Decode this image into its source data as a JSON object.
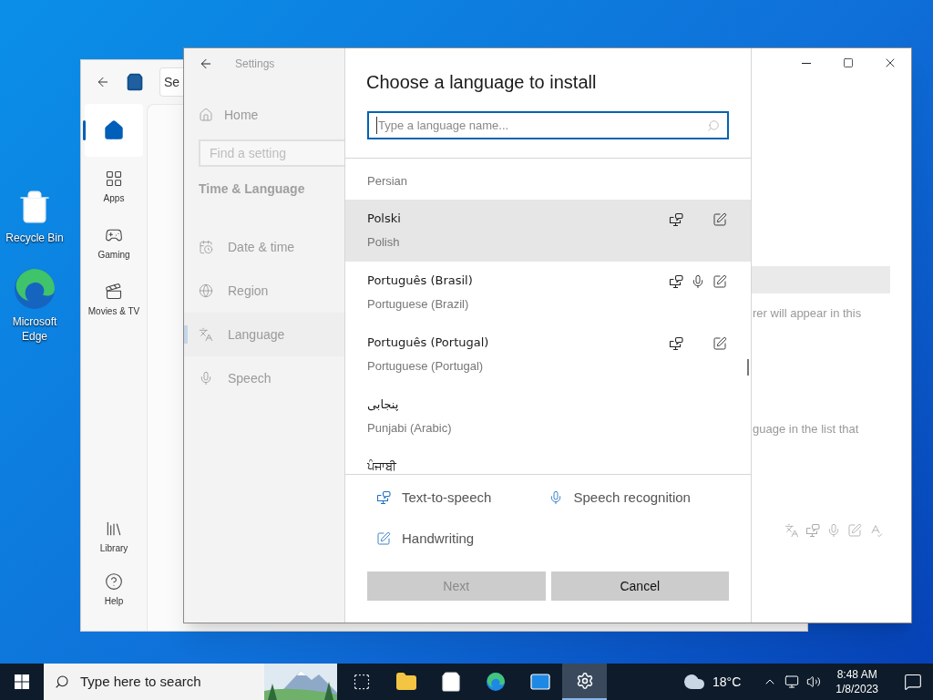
{
  "desktop_icons": [
    {
      "label": "Recycle Bin",
      "kind": "recycle"
    },
    {
      "label": "Microsoft Edge",
      "kind": "edge"
    }
  ],
  "store": {
    "search": "Se",
    "nav": [
      {
        "kind": "home",
        "selected": true
      },
      {
        "label": "Apps",
        "kind": "apps",
        "selected": false
      },
      {
        "label": "Gaming",
        "kind": "gaming",
        "selected": false
      },
      {
        "label": "Movies & TV",
        "kind": "movies",
        "selected": false
      }
    ],
    "nav_bottom": [
      {
        "label": "Library",
        "kind": "library",
        "selected": false
      },
      {
        "label": "Help",
        "kind": "help",
        "selected": false
      }
    ]
  },
  "settings": {
    "title": "Settings",
    "home": "Home",
    "search_placeholder": "Find a setting",
    "section": "Time & Language",
    "nav": [
      {
        "label": "Date & time",
        "kind": "date",
        "selected": false
      },
      {
        "label": "Region",
        "kind": "region",
        "selected": false
      },
      {
        "label": "Language",
        "kind": "language",
        "selected": true
      },
      {
        "label": "Speech",
        "kind": "speech",
        "selected": false
      }
    ],
    "right_texts": [
      "rer will appear in this",
      "guage in the list that"
    ]
  },
  "dialog": {
    "title": "Choose a language to install",
    "search_placeholder": "Type a language name...",
    "languages": [
      {
        "english": "Persian",
        "tts": false,
        "mic": false,
        "handwriting": false,
        "hovered": false
      },
      {
        "native": "Polski",
        "english": "Polish",
        "tts": true,
        "mic": false,
        "handwriting": true,
        "hovered": true
      },
      {
        "native": "Português (Brasil)",
        "english": "Portuguese (Brazil)",
        "tts": true,
        "mic": true,
        "handwriting": true,
        "hovered": false
      },
      {
        "native": "Português (Portugal)",
        "english": "Portuguese (Portugal)",
        "tts": true,
        "mic": false,
        "handwriting": true,
        "hovered": false
      },
      {
        "native": "پنجابی",
        "english": "Punjabi (Arabic)",
        "tts": false,
        "mic": false,
        "handwriting": false,
        "hovered": false
      },
      {
        "native": "ਪੰਜਾਬੀ",
        "tts": false,
        "mic": false,
        "handwriting": false,
        "hovered": false
      }
    ],
    "legend": [
      {
        "kind": "tts",
        "label": "Text-to-speech"
      },
      {
        "kind": "mic",
        "label": "Speech recognition"
      },
      {
        "kind": "handwriting",
        "label": "Handwriting"
      }
    ],
    "buttons": [
      {
        "label": "Next",
        "disabled": true
      },
      {
        "label": "Cancel",
        "disabled": false
      }
    ]
  },
  "taskbar": {
    "search_placeholder": "Type here to search",
    "apps": [
      {
        "kind": "taskview",
        "active": false
      },
      {
        "kind": "explorer",
        "active": false
      },
      {
        "kind": "store",
        "active": false
      },
      {
        "kind": "edge",
        "active": false
      },
      {
        "kind": "mail",
        "active": false
      },
      {
        "kind": "settings",
        "active": true
      }
    ],
    "weather": "18°C",
    "time": "8:48 AM",
    "date": "1/8/2023"
  }
}
